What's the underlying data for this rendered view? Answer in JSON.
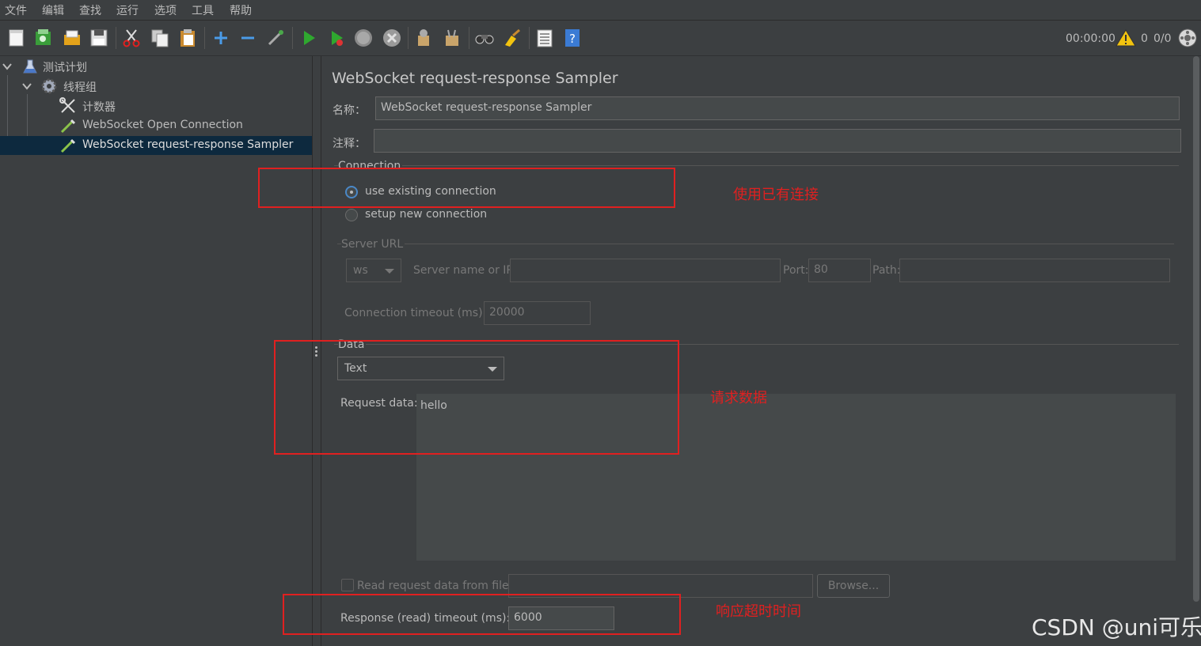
{
  "menu": [
    "文件",
    "编辑",
    "查找",
    "运行",
    "选项",
    "工具",
    "帮助"
  ],
  "toolbar": {
    "timer": "00:00:00",
    "warning_count": "0",
    "thread_count": "0/0",
    "icons": [
      "new-icon",
      "templates-icon",
      "open-icon",
      "save-icon",
      "cut-icon",
      "copy-icon",
      "paste-icon",
      "expand-icon",
      "collapse-icon",
      "toggle-icon",
      "start-icon",
      "start-no-pause-icon",
      "stop-icon",
      "shutdown-icon",
      "clear-icon",
      "clear-all-icon",
      "search-icon",
      "reset-search-icon",
      "function-helper-icon",
      "help-icon"
    ]
  },
  "tree": {
    "items": [
      {
        "label": "测试计划"
      },
      {
        "label": "线程组"
      },
      {
        "label": "计数器"
      },
      {
        "label": "WebSocket Open Connection"
      },
      {
        "label": "WebSocket request-response Sampler"
      }
    ]
  },
  "panel": {
    "title": "WebSocket request-response Sampler",
    "name_label": "名称：",
    "name_value": "WebSocket request-response Sampler",
    "comment_label": "注释：",
    "comment_value": "",
    "connection": {
      "legend": "Connection",
      "use_existing": "use existing connection",
      "setup_new": "setup new connection"
    },
    "server": {
      "legend": "Server URL",
      "protocol": "ws",
      "server_label": "Server name or IP:",
      "server_value": "",
      "port_label": "Port:",
      "port_value": "80",
      "path_label": "Path:",
      "path_value": "",
      "timeout_label": "Connection timeout (ms):",
      "timeout_value": "20000"
    },
    "data": {
      "legend": "Data",
      "type": "Text",
      "request_label": "Request data:",
      "request_value": "hello",
      "file_label": "Read request data from file:",
      "file_value": "",
      "browse": "Browse...",
      "response_timeout_label": "Response (read) timeout (ms):",
      "response_timeout_value": "6000"
    }
  },
  "annotations": {
    "existing": "使用已有连接",
    "request": "请求数据",
    "timeout": "响应超时时间"
  },
  "watermark": "CSDN @uni可乐"
}
